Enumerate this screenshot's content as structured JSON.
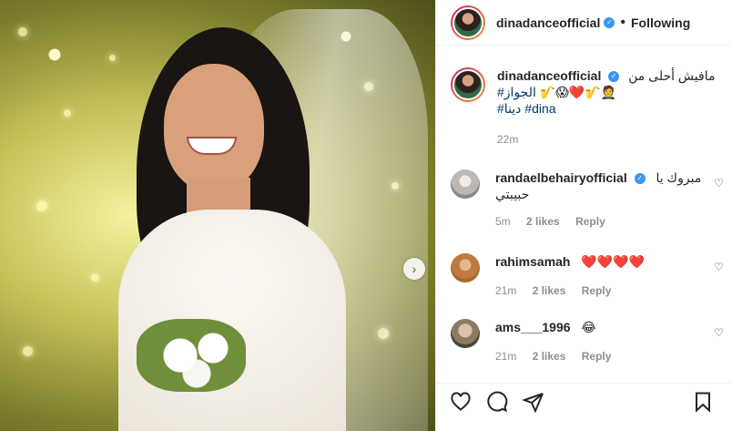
{
  "post": {
    "username": "dinadanceofficial",
    "follow_label": "Following",
    "separator": "•",
    "caption_line1": "مافيش أحلى من",
    "caption_emojis": "🎷😱❤️🎷🤵",
    "caption_tag1": "#الجواز",
    "caption_tags2": "#دينا #dina",
    "time": "22m"
  },
  "comments": [
    {
      "username": "randaelbehairyofficial",
      "verified": true,
      "text_line1": "مبروك يا",
      "text_line2": "حبيبتي",
      "time": "5m",
      "likes": "2 likes",
      "reply": "Reply"
    },
    {
      "username": "rahimsamah",
      "verified": false,
      "text_line1": "❤️❤️❤️❤️",
      "text_line2": "",
      "time": "21m",
      "likes": "2 likes",
      "reply": "Reply"
    },
    {
      "username": "ams___1996",
      "verified": false,
      "text_line1": "😂",
      "text_line2": "",
      "time": "21m",
      "likes": "2 likes",
      "reply": "Reply"
    }
  ],
  "icons": {
    "verified": "verified-badge-icon",
    "like": "heart-icon",
    "comment": "comment-icon",
    "share": "share-icon",
    "save": "bookmark-icon",
    "next": "chevron-right-icon"
  },
  "colors": {
    "accent": "#3897f0",
    "hashtag": "#00376b",
    "meta": "#8e8e8e"
  }
}
